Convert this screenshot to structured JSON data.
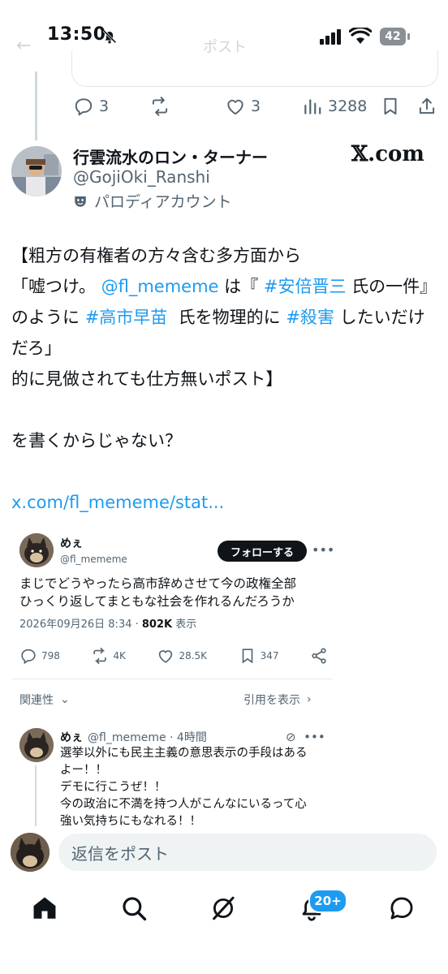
{
  "status_bar": {
    "time": "13:50",
    "battery": "42",
    "ghost_back": "←",
    "ghost_title": "ポスト"
  },
  "prev_post": {
    "replies": "3",
    "likes": "3",
    "views": "3288"
  },
  "post": {
    "name": "行雲流水のロン・ターナー",
    "handle": "@GojiOki_Ranshi",
    "parody_label": "パロディアカウント",
    "watermark": "𝕏.com",
    "line1": "【粗方の有権者の方々含む多方面から",
    "line2a": "「嘘つけ。 ",
    "mention": "@fl_mememe",
    "line2b": " は『 ",
    "hashtag1": "#安倍晋三",
    "line2c": " 氏の一件』のように ",
    "hashtag2": "#高市早苗",
    "line2d": "  氏を物理的に ",
    "hashtag3": "#殺害",
    "line2e": " したいだけだろ」",
    "line3": "的に見做されても仕方無いポスト】",
    "line4": "を書くからじゃない？",
    "url": "x.com/fl_mememe/stat..."
  },
  "quoted": {
    "name": "めぇ",
    "handle": "@fl_mememe",
    "follow_label": "フォローする",
    "text": "まじでどうやったら高市辞めさせて今の政権全部\nひっくり返してまともな社会を作れるんだろうか",
    "timestamp": "2026年09月26日 8:34 · ",
    "views": "802K",
    "views_label": " 表示",
    "replies": "798",
    "reposts": "4K",
    "likes": "28.5K",
    "bookmarks": "347",
    "sort_label": "関連性",
    "quote_label": "引用を表示"
  },
  "quoted_reply": {
    "name": "めぇ",
    "handle_time": "@fl_mememe · 4時間",
    "text": "選挙以外にも民主主義の意思表示の手段はある\nよー！！\nデモに行こうぜ！！\n今の政治に不満を持つ人がこんなにいるって心\n強い気持ちにもなれる！！"
  },
  "reply_bar": {
    "placeholder": "返信をポスト"
  },
  "nav": {
    "notification_badge": "20+"
  },
  "colors": {
    "accent": "#1d9bf0",
    "text": "#0f1419",
    "muted": "#536471"
  }
}
